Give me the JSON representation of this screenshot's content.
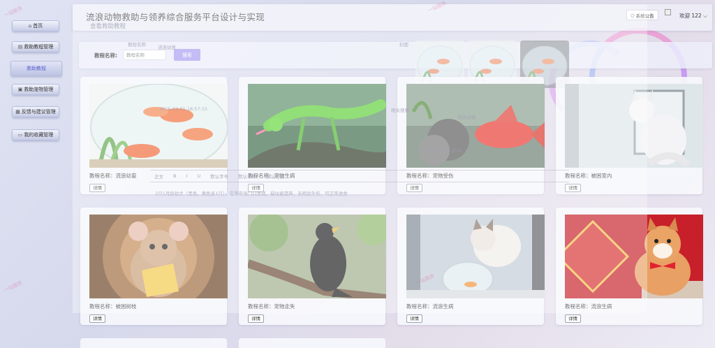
{
  "app": {
    "title": "流浪动物救助与领养综合服务平台设计与实现",
    "breadcrumb": "查看救助教程"
  },
  "header": {
    "notice_label": "系统公告",
    "welcome_text": "欢迎 122"
  },
  "sidebar": {
    "items": [
      {
        "label": "首页"
      },
      {
        "label": "救助教程管理"
      },
      {
        "label": "救助教程"
      },
      {
        "label": "救助宠物管理"
      },
      {
        "label": "反馈与建议管理"
      },
      {
        "label": "我的收藏管理"
      }
    ]
  },
  "search": {
    "label": "教程名称:",
    "placeholder": "教程名称",
    "button": "搜索"
  },
  "cards": [
    {
      "name": "教程名称：流浪幼崽",
      "detail": "详情"
    },
    {
      "name": "教程名称：宠物生病",
      "detail": "详情"
    },
    {
      "name": "教程名称：宠物受伤",
      "detail": "详情"
    },
    {
      "name": "教程名称：被困室内",
      "detail": "详情"
    },
    {
      "name": "教程名称：被困树枝",
      "detail": "详情"
    },
    {
      "name": "教程名称：宠物走失",
      "detail": "详情"
    },
    {
      "name": "教程名称：流浪生病",
      "detail": "详情"
    },
    {
      "name": "教程名称：流浪生病",
      "detail": "详情"
    }
  ],
  "ghost": {
    "tutorial_name_label": "教程名称",
    "tutorial_name_value": "流浪幼崽",
    "cover_label": "封面",
    "date_text": "2025-03-01 18:57:15",
    "related_label": "相关搜索",
    "stray_label": "流浪动物",
    "size_text": "1174 × 856  25%",
    "body_text": "2只1月龄幼犬（黑色、黄色各1只），在菜市场门口发现，疑似被遗弃，无明显外伤，可正常进食",
    "toolbar": [
      "正文",
      "B",
      "I",
      "U",
      "默认字号",
      "默认字体",
      "默认行高"
    ],
    "watermark": "一站服务"
  }
}
